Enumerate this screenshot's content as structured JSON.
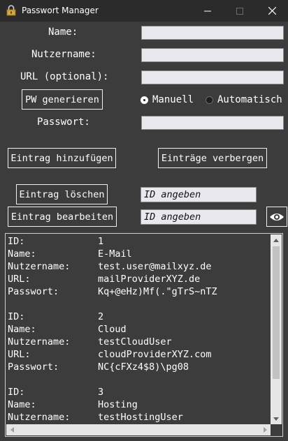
{
  "window": {
    "title": "Passwort Manager",
    "icon": "lock-icon",
    "controls": [
      "minimize-icon",
      "maximize-icon",
      "close-icon"
    ]
  },
  "form": {
    "name_label": "Name:",
    "username_label": "Nutzername:",
    "url_label": "URL (optional):",
    "password_label": "Passwort:",
    "name_value": "",
    "username_value": "",
    "url_value": "",
    "password_value": ""
  },
  "generator": {
    "button_label": "PW generieren",
    "manual_label": "Manuell",
    "auto_label": "Automatisch",
    "selected": "Manuell"
  },
  "actions": {
    "add_label": "Eintrag hinzufügen",
    "hide_label": "Einträge verbergen",
    "delete_label": "Eintrag löschen",
    "edit_label": "Eintrag bearbeiten",
    "delete_id_value": "ID angeben",
    "edit_id_value": "ID angeben",
    "reveal_icon": "eye-icon"
  },
  "listing": {
    "keys": {
      "id": "ID:",
      "name": "Name:",
      "user": "Nutzername:",
      "url": "URL:",
      "pw": "Passwort:"
    },
    "entries": [
      {
        "id": "1",
        "name": "E-Mail",
        "user": "test.user@mailxyz.de",
        "url": "mailProviderXYZ.de",
        "pw": "Kq+@eHz)Mf(.\"gTrS~nTZ"
      },
      {
        "id": "2",
        "name": "Cloud",
        "user": "testCloudUser",
        "url": "cloudProviderXYZ.com",
        "pw": "NC{cFXz4$8)\\pg08"
      },
      {
        "id": "3",
        "name": "Hosting",
        "user": "testHostingUser"
      }
    ]
  },
  "colors": {
    "background": "#3c3c3c",
    "titlebar": "#2b2b2b",
    "entry_bg": "#e8e8ee",
    "text": "#ffffff"
  }
}
